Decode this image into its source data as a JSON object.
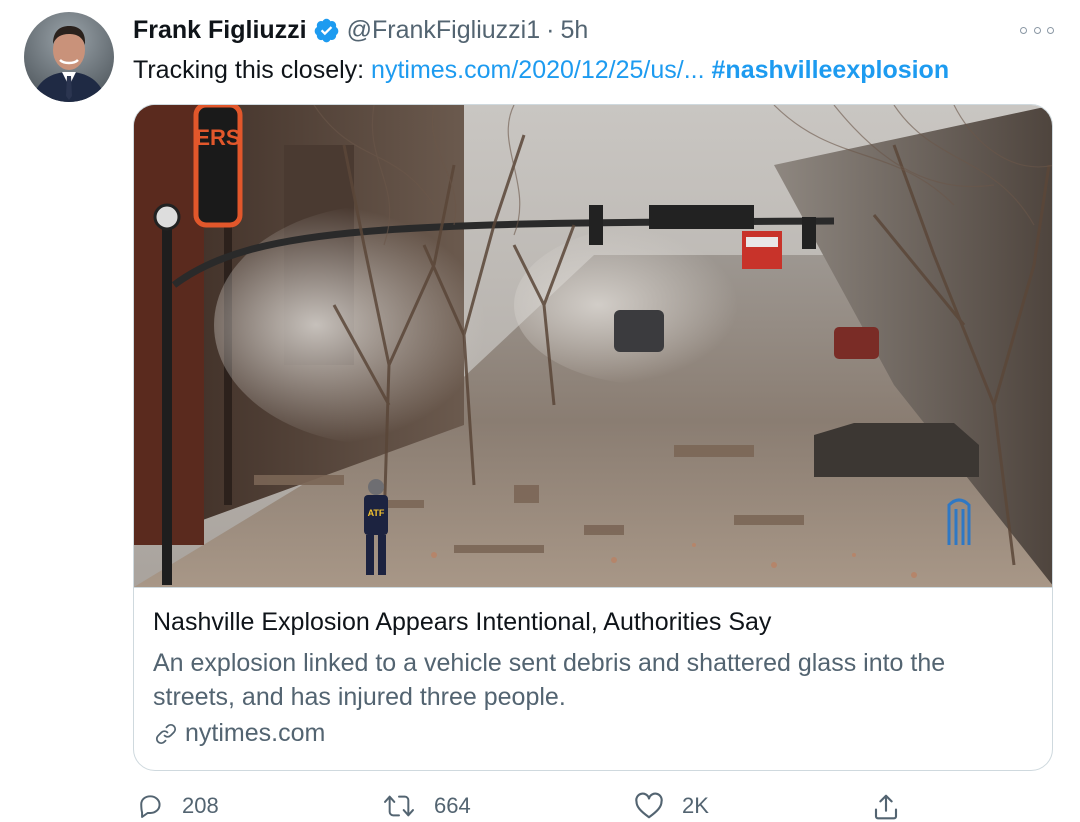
{
  "tweet": {
    "author": {
      "display_name": "Frank Figliuzzi",
      "handle": "@FrankFigliuzzi1",
      "verified": true
    },
    "separator": "·",
    "time": "5h",
    "text_prefix": "Tracking this closely: ",
    "link_text": "nytimes.com/2020/12/25/us/...",
    "hashtag": "#nashvilleexplosion"
  },
  "card": {
    "title": "Nashville Explosion Appears Intentional, Authorities Say",
    "description": "An explosion linked to a vehicle sent debris and shattered glass into the streets, and has injured three people.",
    "domain": "nytimes.com",
    "sign_text": "ERS",
    "vest_text": "ATF"
  },
  "actions": {
    "replies": "208",
    "retweets": "664",
    "likes": "2K"
  },
  "colors": {
    "accent": "#1d9bf0",
    "secondary_text": "#536471",
    "border": "#cfd9de"
  },
  "icons": {
    "verified": "verified-badge-icon",
    "more": "more-options-icon",
    "reply": "reply-icon",
    "retweet": "retweet-icon",
    "like": "heart-icon",
    "share": "share-icon",
    "link": "link-icon"
  }
}
